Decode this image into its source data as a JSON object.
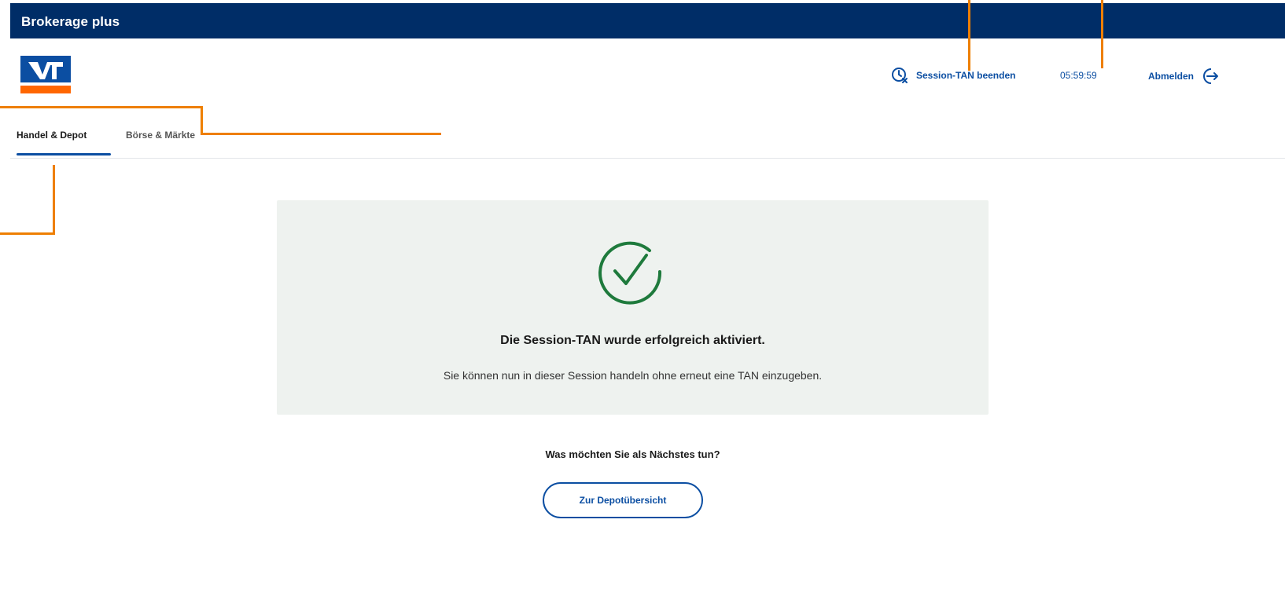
{
  "appbar": {
    "title": "Brokerage plus"
  },
  "header": {
    "session_end_label": "Session-TAN beenden",
    "timer": "05:59:59",
    "logout_label": "Abmelden"
  },
  "tabs": [
    {
      "label": "Handel & Depot",
      "active": true
    },
    {
      "label": "Börse & Märkte",
      "active": false
    }
  ],
  "success": {
    "title": "Die Session-TAN wurde erfolgreich aktiviert.",
    "subtitle": "Sie können nun in dieser Session handeln ohne erneut eine TAN einzugeben."
  },
  "next": {
    "question": "Was möchten Sie als Nächstes tun?",
    "button_label": "Zur Depotübersicht"
  },
  "colors": {
    "appbar": "#002d67",
    "link": "#0b4ea2",
    "success_green": "#1e7a3c",
    "annotation": "#ee7f00",
    "logo_orange": "#ff6600"
  },
  "icons": [
    "logo-icon",
    "session-timer-icon",
    "logout-icon",
    "success-check-icon"
  ]
}
